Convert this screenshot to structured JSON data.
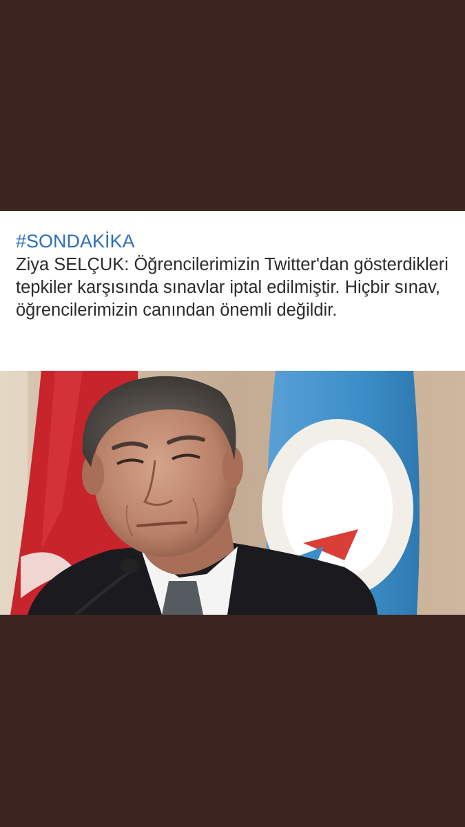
{
  "post": {
    "hashtag": "#SONDAKİKA",
    "headline": "Ziya SELÇUK: Öğrencilerimizin Twitter'dan gösterdikleri tepkiler karşısında sınavlar iptal edilmiştir. Hiçbir sınav, öğrencilerimizin canından önemli değildir."
  },
  "colors": {
    "background": "#3c2521",
    "card": "#ffffff",
    "hashtag": "#2e6fb8",
    "headline_text": "#2b2b2b",
    "flag_red": "#c8242b",
    "flag_blue": "#3d8fc9"
  },
  "photo": {
    "subject": "man-in-suit-portrait",
    "background_elements": [
      "turkish-flag",
      "blue-institutional-flag",
      "microphone"
    ]
  }
}
